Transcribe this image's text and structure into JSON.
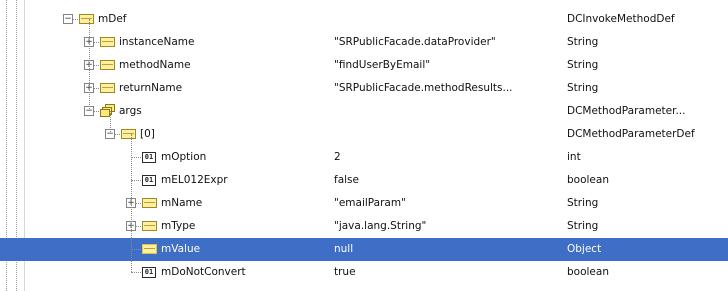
{
  "rows": [
    {
      "label": "mDef",
      "value": "",
      "type": "DCInvokeMethodDef",
      "level": 0,
      "icon": "object-icon",
      "expander": "minus"
    },
    {
      "label": "instanceName",
      "value": "\"SRPublicFacade.dataProvider\"",
      "type": "String",
      "level": 1,
      "icon": "object-icon",
      "expander": "plus"
    },
    {
      "label": "methodName",
      "value": "\"findUserByEmail\"",
      "type": "String",
      "level": 1,
      "icon": "object-icon",
      "expander": "plus"
    },
    {
      "label": "returnName",
      "value": "\"SRPublicFacade.methodResults...",
      "type": "String",
      "level": 1,
      "icon": "object-icon",
      "expander": "plus"
    },
    {
      "label": "args",
      "value": "",
      "type": "DCMethodParameter...",
      "level": 1,
      "icon": "array-icon",
      "expander": "minus"
    },
    {
      "label": "[0]",
      "value": "",
      "type": "DCMethodParameterDef",
      "level": 2,
      "icon": "object-icon",
      "expander": "minus"
    },
    {
      "label": "mOption",
      "value": "2",
      "type": "int",
      "level": 3,
      "icon": "primitive-icon",
      "expander": "none"
    },
    {
      "label": "mEL012Expr",
      "value": "false",
      "type": "boolean",
      "level": 3,
      "icon": "primitive-icon",
      "expander": "none"
    },
    {
      "label": "mName",
      "value": "\"emailParam\"",
      "type": "String",
      "level": 3,
      "icon": "object-icon",
      "expander": "plus"
    },
    {
      "label": "mType",
      "value": "\"java.lang.String\"",
      "type": "String",
      "level": 3,
      "icon": "object-icon",
      "expander": "plus"
    },
    {
      "label": "mValue",
      "value": "null",
      "type": "Object",
      "level": 3,
      "icon": "object-icon",
      "expander": "none",
      "selected": true
    },
    {
      "label": "mDoNotConvert",
      "value": "true",
      "type": "boolean",
      "level": 3,
      "icon": "primitive-icon",
      "expander": "none"
    }
  ],
  "primitive_icon_text": "01",
  "colors": {
    "selection": "#3f6ec6",
    "object_icon_fill": "#ffef9e"
  }
}
